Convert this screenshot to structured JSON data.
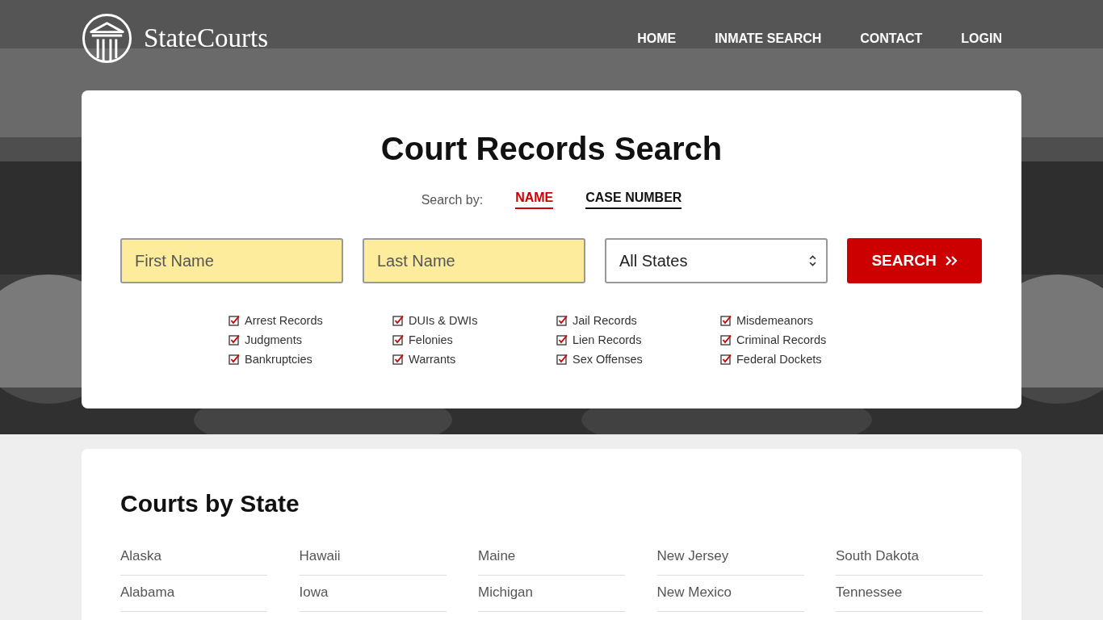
{
  "header": {
    "logo": "StateCourts",
    "nav": [
      {
        "label": "HOME"
      },
      {
        "label": "INMATE SEARCH"
      },
      {
        "label": "CONTACT"
      },
      {
        "label": "LOGIN"
      }
    ]
  },
  "search": {
    "title": "Court Records Search",
    "search_by_label": "Search by:",
    "tabs": [
      {
        "label": "NAME",
        "selected": true
      },
      {
        "label": "CASE NUMBER",
        "selected": false
      }
    ],
    "fields": [
      {
        "placeholder": "First Name"
      },
      {
        "placeholder": "Last Name"
      }
    ],
    "state_select": {
      "value": "All States"
    },
    "button": "SEARCH",
    "record_types": [
      {
        "label": "Arrest Records",
        "checked": true
      },
      {
        "label": "Judgments",
        "checked": true
      },
      {
        "label": "Bankruptcies",
        "checked": true
      },
      {
        "label": "DUIs & DWIs",
        "checked": true
      },
      {
        "label": "Felonies",
        "checked": true
      },
      {
        "label": "Warrants",
        "checked": true
      },
      {
        "label": "Jail Records",
        "checked": true
      },
      {
        "label": "Lien Records",
        "checked": true
      },
      {
        "label": "Sex Offenses",
        "checked": true
      },
      {
        "label": "Misdemeanors",
        "checked": true
      },
      {
        "label": "Criminal Records",
        "checked": true
      },
      {
        "label": "Federal Dockets",
        "checked": true
      }
    ]
  },
  "courts_by_state": {
    "title": "Courts by State",
    "states": [
      "Alaska",
      "Hawaii",
      "Maine",
      "New Jersey",
      "South Dakota",
      "Alabama",
      "Iowa",
      "Michigan",
      "New Mexico",
      "Tennessee"
    ]
  }
}
